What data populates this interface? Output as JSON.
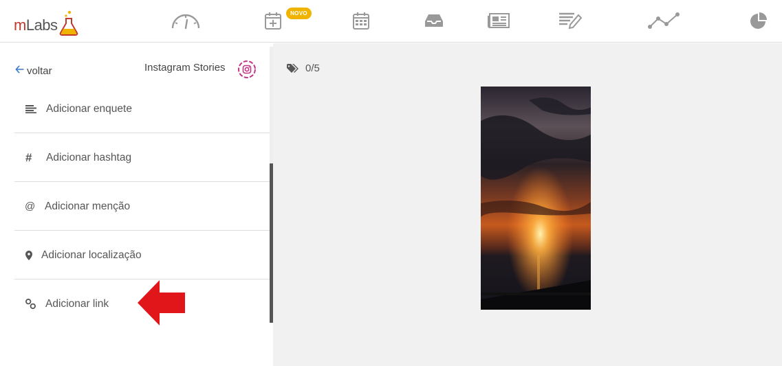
{
  "app": {
    "logo_text_m": "m",
    "logo_text_rest": "Labs"
  },
  "nav": {
    "badge": "NOVO",
    "icons": [
      "dashboard-icon",
      "calendar-add-icon",
      "calendar-icon",
      "inbox-icon",
      "newspaper-icon",
      "report-edit-icon",
      "analytics-line-icon",
      "pie-chart-icon"
    ]
  },
  "panel": {
    "back_label": "voltar",
    "network_label": "Instagram Stories",
    "items": [
      {
        "icon": "align-left-icon",
        "label": "Adicionar enquete"
      },
      {
        "icon": "hashtag-icon",
        "glyph": "#",
        "label": "Adicionar hashtag"
      },
      {
        "icon": "at-icon",
        "glyph": "@",
        "label": "Adicionar menção"
      },
      {
        "icon": "map-pin-icon",
        "label": "Adicionar localização"
      },
      {
        "icon": "link-icon",
        "label": "Adicionar link"
      }
    ]
  },
  "preview": {
    "tag_count": "0/5"
  },
  "colors": {
    "accent_blue": "#3a7bc8",
    "badge_yellow": "#f0b400",
    "logo_red": "#c0392b",
    "arrow_red": "#e0161b"
  }
}
